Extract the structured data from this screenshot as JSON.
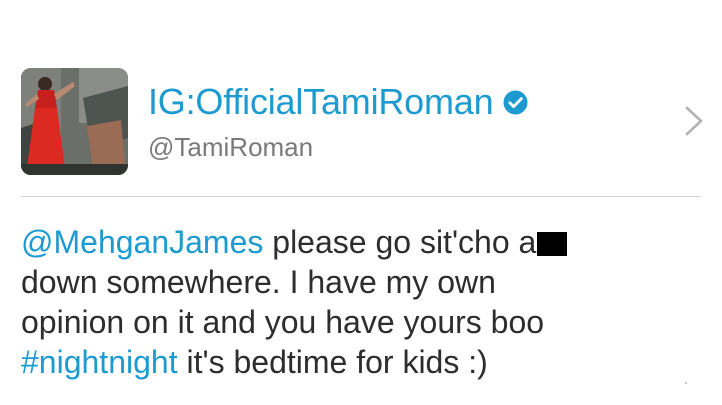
{
  "profile": {
    "display_name": "IG:OfficialTamiRoman",
    "handle": "@TamiRoman",
    "verified": true,
    "avatar_icon": "profile-photo"
  },
  "tweet": {
    "line1_mention": "@MehganJames",
    "line1_text": " please go sit'cho a",
    "line2_text": "down somewhere. I have my own",
    "line3_text": "opinion on it and you have yours boo",
    "line4_hashtag": "#nightnight",
    "line4_text": " it's bedtime for kids :)"
  },
  "icons": {
    "verified": "verified-badge-icon",
    "chevron": "chevron-right-icon"
  },
  "colors": {
    "link": "#1d9bd1",
    "text": "#2d2d2d",
    "handle": "#7a7a7a",
    "divider": "#d4d4d4",
    "censor": "#000000"
  }
}
